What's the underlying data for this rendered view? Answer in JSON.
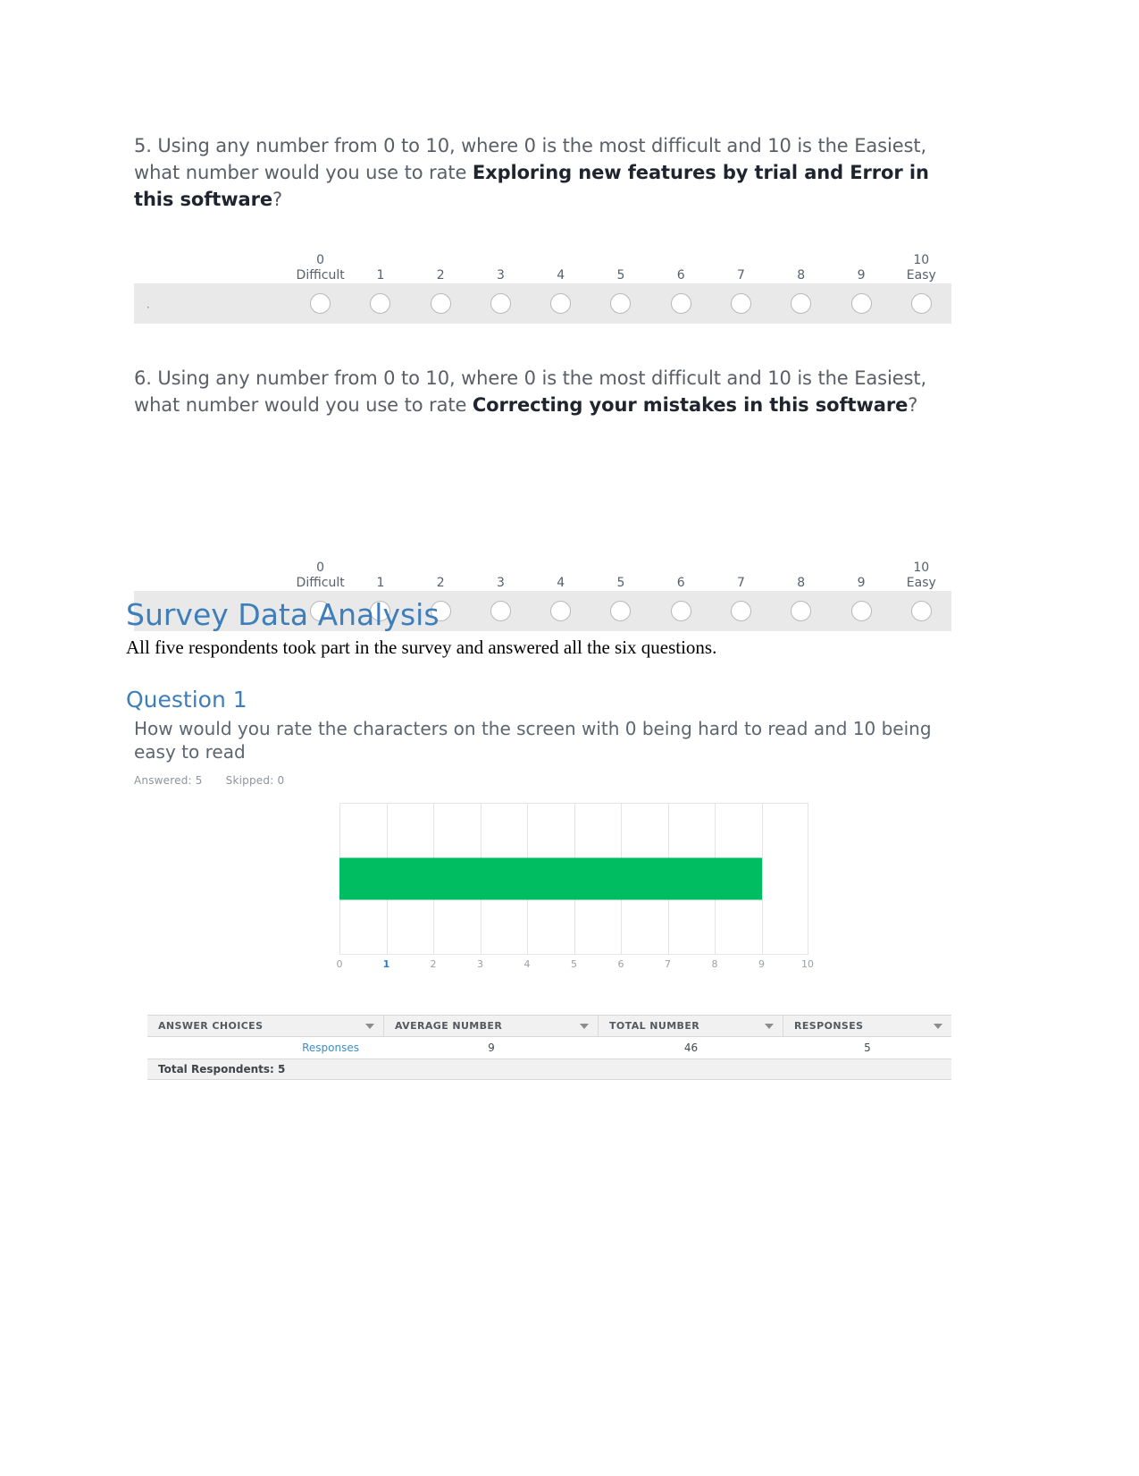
{
  "questions": [
    {
      "number": "5.",
      "prefix": "5. Using any number from 0 to 10, where 0 is the most difficult and 10 is the Easiest, what number would you use to rate ",
      "bold": "Exploring new features by trial and Error in this software",
      "suffix": "?",
      "scale": {
        "low_value": "0",
        "low_label": "Difficult",
        "high_value": "10",
        "high_label": "Easy",
        "middle": [
          "1",
          "2",
          "3",
          "4",
          "5",
          "6",
          "7",
          "8",
          "9"
        ]
      }
    },
    {
      "number": "6.",
      "prefix": "6. Using any number from 0 to 10, where 0 is the most difficult and 10 is the Easiest, what number would you use to rate ",
      "bold": "Correcting your mistakes in this software",
      "suffix": "?",
      "scale": {
        "low_value": "0",
        "low_label": "Difficult",
        "high_value": "10",
        "high_label": "Easy",
        "middle": [
          "1",
          "2",
          "3",
          "4",
          "5",
          "6",
          "7",
          "8",
          "9"
        ]
      }
    }
  ],
  "section": {
    "heading": "Survey Data Analysis",
    "intro": "All five respondents took part in the survey and answered all the six questions.",
    "subheading": "Question 1"
  },
  "report": {
    "question_text": "How would you rate the characters on the screen with 0 being hard to read and 10 being easy to read",
    "answered_label": "Answered: 5",
    "skipped_label": "Skipped: 0",
    "table": {
      "headers": [
        "ANSWER CHOICES",
        "AVERAGE NUMBER",
        "TOTAL NUMBER",
        "RESPONSES"
      ],
      "rows": [
        {
          "choice": "Responses",
          "average": "9",
          "total": "46",
          "responses": "5"
        }
      ],
      "footer": "Total Respondents: 5"
    }
  },
  "chart_data": {
    "type": "bar",
    "orientation": "horizontal",
    "title": "How would you rate the characters on the screen with 0 being hard to read and 10 being easy to read",
    "categories": [
      "Responses"
    ],
    "values": [
      9
    ],
    "series": [
      {
        "name": "Responses",
        "values": [
          9
        ],
        "color": "#00bd62"
      }
    ],
    "xlabel": "",
    "ylabel": "",
    "xlim": [
      0,
      10
    ],
    "x_ticks": [
      "0",
      "1",
      "2",
      "3",
      "4",
      "5",
      "6",
      "7",
      "8",
      "9",
      "10"
    ],
    "highlighted_tick": "1",
    "grid": true,
    "legend": "none",
    "answered": 5,
    "skipped": 0,
    "average_number": 9,
    "total_number": 46,
    "responses": 5,
    "total_respondents": 5
  },
  "colors": {
    "bar_green": "#00bd62",
    "heading_blue": "#3d7ebb",
    "tick_highlight": "#2f7dc0",
    "scale_band": "#e9e9e9"
  }
}
